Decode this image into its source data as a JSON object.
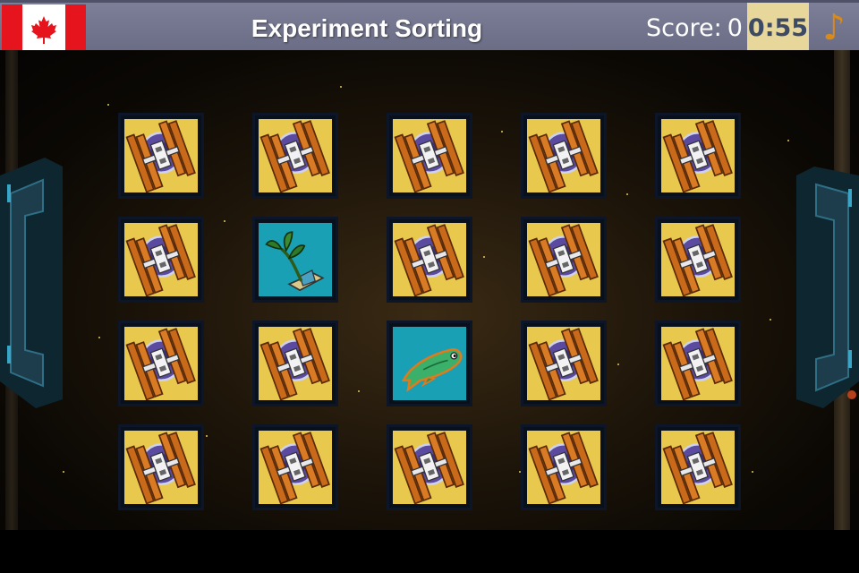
{
  "header": {
    "title": "Experiment Sorting",
    "score_label": "Score:",
    "score_value": "0",
    "timer": "0:55",
    "music_icon": "music-note-icon",
    "flag_icon": "canada-flag-icon"
  },
  "board": {
    "rows": 4,
    "cols": 5,
    "cards": [
      [
        "back",
        "back",
        "back",
        "back",
        "back"
      ],
      [
        "back",
        "plant",
        "back",
        "back",
        "back"
      ],
      [
        "back",
        "back",
        "fish",
        "back",
        "back"
      ],
      [
        "back",
        "back",
        "back",
        "back",
        "back"
      ]
    ],
    "card_back_icon": "space-station-icon",
    "face_icons": {
      "plant": "plant-experiment-icon",
      "fish": "fish-experiment-icon"
    }
  },
  "colors": {
    "topbar": "#747690",
    "timer_bg": "#e7d79b",
    "timer_text": "#3c4a66",
    "card_back": "#e9c84e",
    "card_face": "#1aa0b4",
    "music": "#d98a17"
  }
}
